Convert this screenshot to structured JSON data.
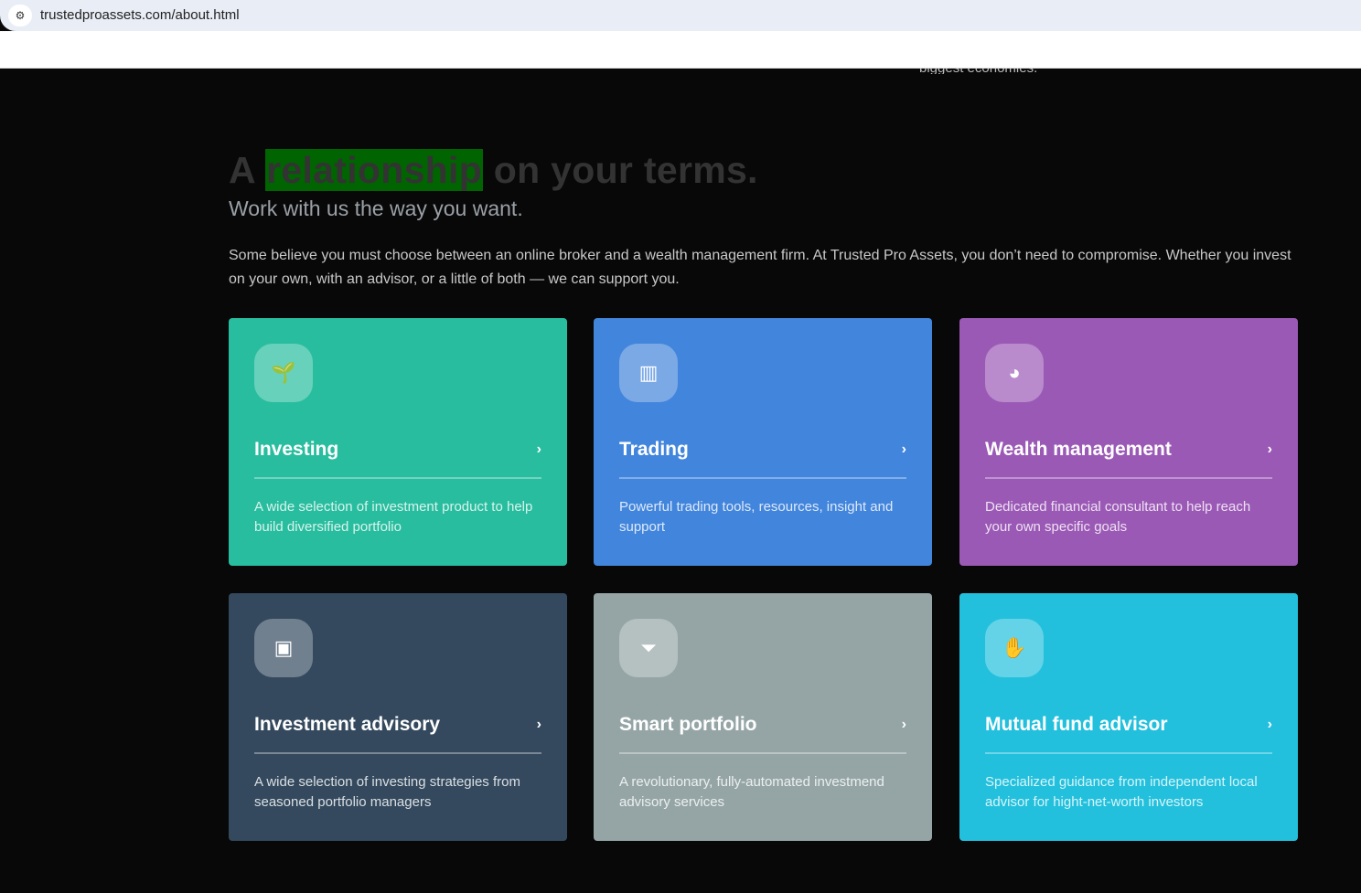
{
  "browser": {
    "url": "trustedproassets.com/about.html"
  },
  "top_cut_text": "biggest economies.",
  "heading": {
    "prefix": "A",
    "highlight": "relationship",
    "suffix": "on your terms."
  },
  "subheading": "Work with us the way you want.",
  "intro": "Some believe you must choose between an online broker and a wealth management firm. At Trusted Pro Assets, you don’t need to compromise. Whether you invest on your own, with an advisor, or a little of both — we can support you.",
  "cards": [
    {
      "title": "Investing",
      "desc": "A wide selection of investment product to help build diversified portfolio",
      "icon": "sprout-icon",
      "color": "#28bd9e"
    },
    {
      "title": "Trading",
      "desc": "Powerful trading tools, resources, insight and support",
      "icon": "bar-chart-icon",
      "color": "#4285dc"
    },
    {
      "title": "Wealth management",
      "desc": "Dedicated financial consultant to help reach your own specific goals",
      "icon": "pie-chart-icon",
      "color": "#9b59b6"
    },
    {
      "title": "Investment advisory",
      "desc": "A wide selection of investing strategies from seasoned portfolio managers",
      "icon": "presentation-icon",
      "color": "#34495e"
    },
    {
      "title": "Smart portfolio",
      "desc": "A revolutionary, fully-automated investmend advisory services",
      "icon": "funnel-dollar-icon",
      "color": "#95a5a6"
    },
    {
      "title": "Mutual fund advisor",
      "desc": "Specialized guidance from independent local advisor for hight-net-worth investors",
      "icon": "handshake-icon",
      "color": "#22c0dd"
    }
  ]
}
